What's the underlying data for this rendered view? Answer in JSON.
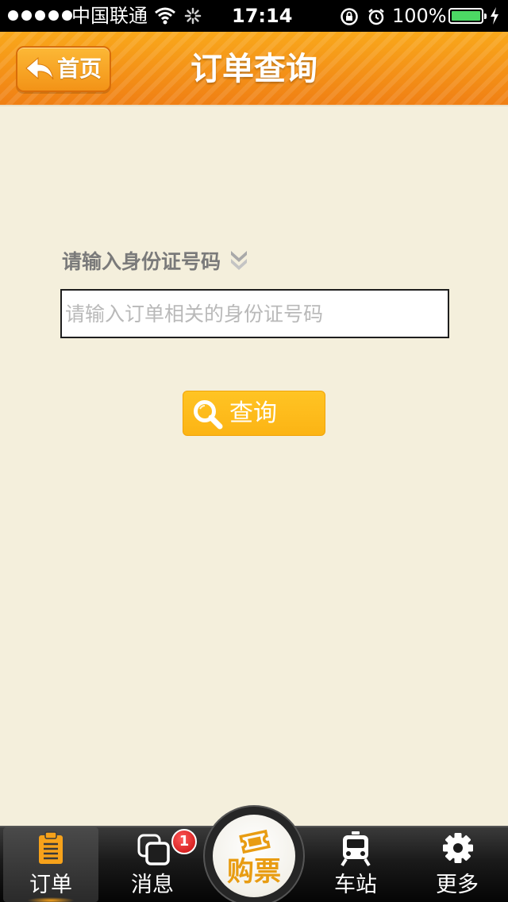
{
  "status_bar": {
    "carrier": "中国联通",
    "time": "17:14",
    "battery_percent": "100%",
    "battery_level": 1.0,
    "icons": [
      "signal-dots-icon",
      "wifi-icon",
      "activity-spinner-icon",
      "rotation-lock-icon",
      "alarm-icon",
      "battery-icon",
      "charging-bolt-icon"
    ]
  },
  "nav": {
    "back_label": "首页",
    "title": "订单查询",
    "back_icon": "back-arrow-icon"
  },
  "form": {
    "id_label": "请输入身份证号码",
    "dropdown_icon": "double-chevron-down-icon",
    "id_input": {
      "value": "",
      "placeholder": "请输入订单相关的身份证号码"
    },
    "query_label": "查询",
    "query_icon": "search-icon"
  },
  "tab_bar": {
    "tabs": [
      {
        "label": "订单",
        "icon": "clipboard-icon",
        "selected": true
      },
      {
        "label": "消息",
        "icon": "messages-icon",
        "badge": "1"
      },
      {
        "label": "购票",
        "icon": "ticket-icon"
      },
      {
        "label": "车站",
        "icon": "train-icon"
      },
      {
        "label": "更多",
        "icon": "gear-icon"
      }
    ]
  },
  "colors": {
    "nav_orange": "#f79a18",
    "accent_yellow": "#fcb414",
    "background": "#f4efdc",
    "badge_red": "#d61414",
    "tab_bar_dark": "#1a1a1a",
    "buy_label_orange": "#e89c12"
  }
}
